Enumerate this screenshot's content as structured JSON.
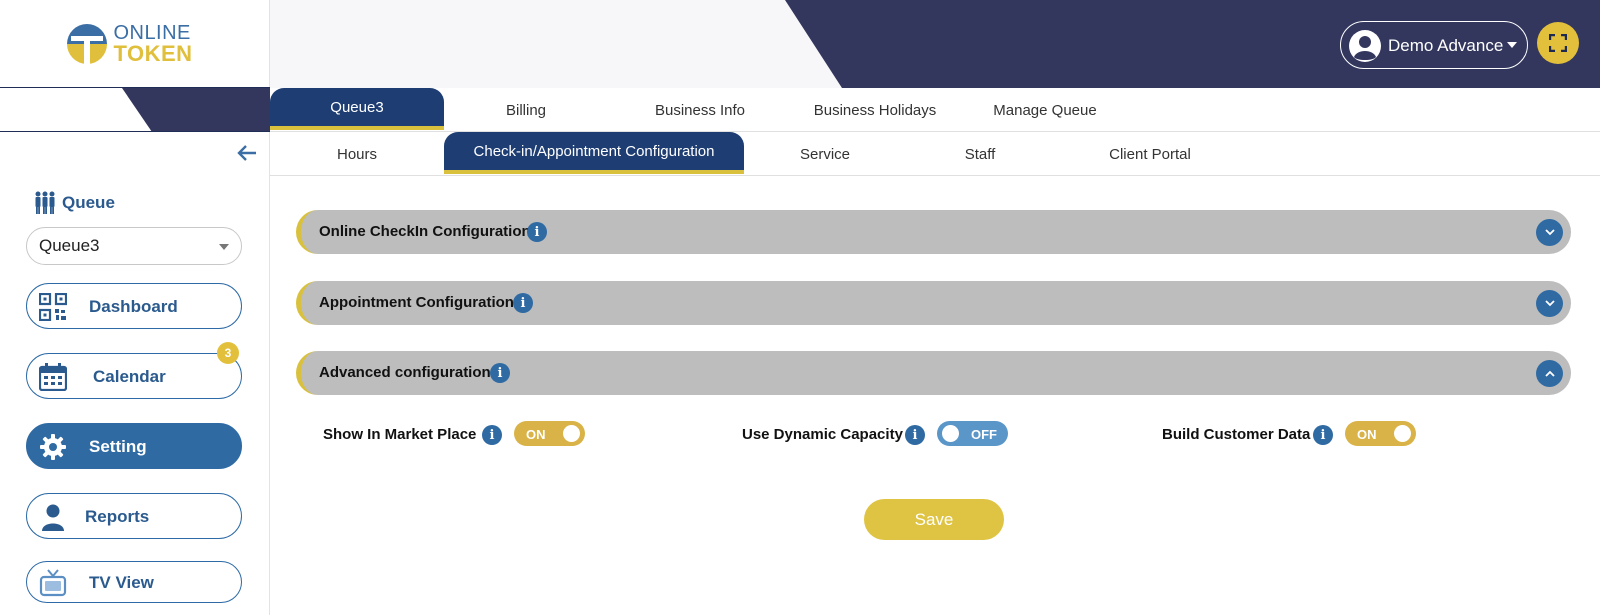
{
  "app": {
    "logo_line1": "ONLINE",
    "logo_line2": "TOKEN"
  },
  "header": {
    "user_name": "Demo Advance"
  },
  "sidebar": {
    "queue_label": "Queue",
    "queue_select_value": "Queue3",
    "nav": [
      {
        "label": "Dashboard",
        "icon": "qr-code-icon"
      },
      {
        "label": "Calendar",
        "icon": "calendar-icon",
        "badge": "3"
      },
      {
        "label": "Setting",
        "icon": "gear-icon",
        "active": true
      },
      {
        "label": "Reports",
        "icon": "person-icon"
      },
      {
        "label": "TV View",
        "icon": "tv-icon"
      }
    ]
  },
  "tabs_row1": [
    "Queue3",
    "Billing",
    "Business Info",
    "Business Holidays",
    "Manage Queue"
  ],
  "tabs_row2": [
    "Hours",
    "Check-in/Appointment Configuration",
    "Service",
    "Staff",
    "Client Portal"
  ],
  "sections": [
    {
      "title": "Online CheckIn Configuration",
      "expanded": false
    },
    {
      "title": "Appointment Configuration",
      "expanded": false
    },
    {
      "title": "Advanced configuration",
      "expanded": true
    }
  ],
  "options": [
    {
      "label": "Show In Market Place",
      "state": "ON"
    },
    {
      "label": "Use Dynamic Capacity",
      "state": "OFF"
    },
    {
      "label": "Build Customer Data",
      "state": "ON"
    }
  ],
  "save_label": "Save",
  "colors": {
    "navy": "#1e3e73",
    "header_dark": "#33375e",
    "primary": "#2f6aa3",
    "accent_yellow": "#d9c13d",
    "switch_on": "#d9b347",
    "switch_off": "#5b96c9"
  }
}
